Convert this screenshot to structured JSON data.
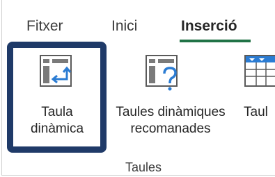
{
  "tabs": [
    {
      "label": "Fitxer"
    },
    {
      "label": "Inici"
    },
    {
      "label": "Inserció",
      "active": true
    }
  ],
  "buttons": {
    "pivot_table": {
      "line1": "Taula",
      "line2": "dinàmica",
      "icon": "pivot-table-icon"
    },
    "recommended_pivot": {
      "line1": "Taules dinàmiques",
      "line2": "recomanades",
      "icon": "recommended-pivot-table-icon"
    },
    "table": {
      "line1": "Taul",
      "icon": "table-icon"
    }
  },
  "group": {
    "label": "Taules"
  },
  "colors": {
    "accent": "#217346",
    "highlight": "#1f3a68",
    "icon_blue": "#2b7cd3"
  }
}
